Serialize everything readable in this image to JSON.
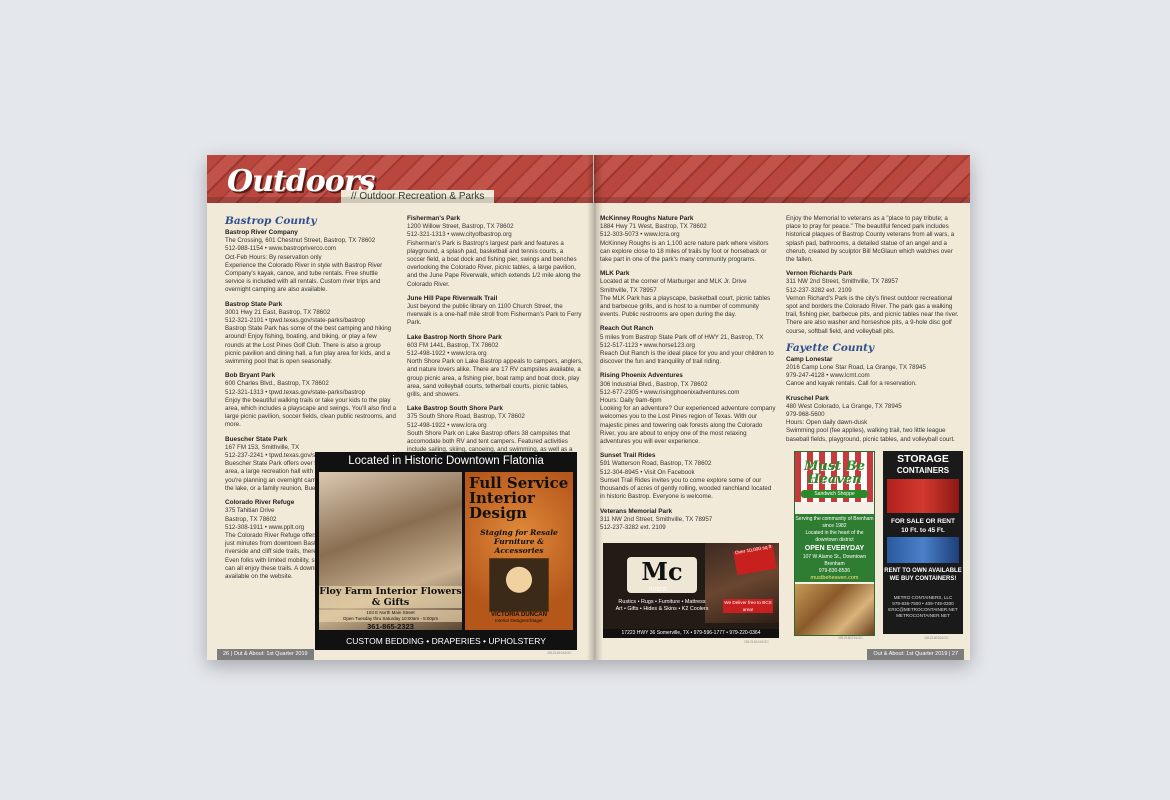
{
  "header": {
    "title": "Outdoors",
    "subtitle": "// Outdoor Recreation & Parks"
  },
  "left_page": {
    "col1": [
      {
        "type": "county",
        "text": "Bastrop County"
      },
      {
        "type": "entry",
        "name": "Bastrop River Company",
        "body": "The Crossing, 601 Chestnut Street, Bastrop, TX 78602\n512-988-1154 • www.bastropriverco.com\nOct-Feb Hours: By reservation only\nExperience the Colorado River in style with Bastrop River Company's kayak, canoe, and tube rentals. Free shuttle service is included with all rentals. Custom river trips and overnight camping are also available."
      },
      {
        "type": "entry",
        "name": "Bastrop State Park",
        "body": "3001 Hwy 21 East, Bastrop, TX 78602\n512-321-2101 • tpwd.texas.gov/state-parks/bastrop\nBastrop State Park has some of the best camping and hiking around! Enjoy fishing, boating, and biking, or play a few rounds at the Lost Pines Golf Club. There is also a group picnic pavilion and dining hall, a fun play area for kids, and a swimming pool that is open seasonally."
      },
      {
        "type": "entry",
        "name": "Bob Bryant Park",
        "body": "600 Charles Blvd., Bastrop, TX 78602\n512-321-1313 • tpwd.texas.gov/state-parks/bastrop\nEnjoy the beautiful walking trails or take your kids to the play area, which includes a playscape and swings. You'll also find a large picnic pavilion, soccer fields, clean public restrooms, and more."
      },
      {
        "type": "entry",
        "name": "Buescher State Park",
        "body": "167 FM 153, Smithville, TX\n512-237-2241 • tpwd.texas.gov/state-parks/buescher\nBuescher State Park offers over 50 campsites, a group picnic area, a large recreation hall with a kitchen, and more. Whether you're planning an overnight camping trip, a day of fishing at the lake, or a family reunion, Buescher State Park has it all."
      },
      {
        "type": "entry",
        "name": "Colorado River Refuge",
        "body": "375 Tahitian Drive\nBastrop, TX 78602\n512-308-1911 • www.pplt.org\nThe Colorado River Refuge offers a true nature experience just minutes from downtown Bastrop. With over 2 miles of riverside and cliff side trails, there is something for everyone. Even folks with limited mobility, strollers, and young children can all enjoy these trails. A downloadable Trail Guide is available on the website."
      }
    ],
    "col2": [
      {
        "type": "entry",
        "name": "Fisherman's Park",
        "body": "1200 Willow Street, Bastrop, TX 78602\n512-321-1313 • www.cityofbastrop.org\nFisherman's Park is Bastrop's largest park and features a playground, a splash pad, basketball and tennis courts, a soccer field, a boat dock and fishing pier, swings and benches overlooking the Colorado River, picnic tables, a large pavilion, and the June Pape Riverwalk, which extends 1/2 mile along the Colorado River."
      },
      {
        "type": "entry",
        "name": "June Hill Pape Riverwalk Trail",
        "body": "Just beyond the public library on 1100 Church Street, the riverwalk is a one-half mile stroll from Fisherman's Park to Ferry Park."
      },
      {
        "type": "entry",
        "name": "Lake Bastrop North Shore Park",
        "body": "603 FM 1441, Bastrop, TX 78602\n512-498-1922 • www.lcra.org\nNorth Shore Park on Lake Bastrop appeals to campers, anglers, and nature lovers alike. There are 17 RV campsites available, a group picnic area, a fishing pier, boat ramp and boat dock, play area, sand volleyball courts, tetherball courts, picnic tables, grills, and showers."
      },
      {
        "type": "entry",
        "name": "Lake Bastrop South Shore Park",
        "body": "375 South Shore Road, Bastrop, TX 78602\n512-498-1922 • www.lcra.org\nSouth Shore Park on Lake Bastrop offers 38 campsites that accomodate both RV and tent campers. Featured activities include sailing, skiing, canoeing, and swimming, as well as a hike and bike trail, tetherball courts, and Osprey Point Hall."
      }
    ],
    "footer": "26 | Out & About: 1st Quarter 2019"
  },
  "right_page": {
    "col1": [
      {
        "type": "entry",
        "name": "McKinney Roughs Nature Park",
        "body": "1884 Hwy 71 West, Bastrop, TX 78602\n512-303-5073 • www.lcra.org\nMcKinney Roughs is an 1,100 acre nature park where visitors can explore close to 18 miles of trails by foot or horseback or take part in one of the park's many community programs."
      },
      {
        "type": "entry",
        "name": "MLK Park",
        "body": "Located at the corner of Marburger and MLK Jr. Drive\nSmithville, TX 78957\nThe MLK Park has a playscape, basketball court, picnic tables and barbecue grills, and is host to a number of community events. Public restrooms are open during the day."
      },
      {
        "type": "entry",
        "name": "Reach Out Ranch",
        "body": "5 miles from Bastrop State Park off of HWY 21, Bastrop, TX\n512-517-1123 • www.horse123.org\nReach Out Ranch is the ideal place for you and your children to discover the fun and tranquility of trail riding."
      },
      {
        "type": "entry",
        "name": "Rising Phoenix Adventures",
        "body": "306 Industrial Blvd., Bastrop, TX 78602\n512-677-2305 • www.risingphoenixadventures.com\nHours: Daily 9am-6pm\nLooking for an adventure? Our experienced adventure company welcomes you to the Lost Pines region of Texas. With our majestic pines and towering oak forests along the Colorado River, you are about to enjoy one of the most relaxing adventures you will ever experience."
      },
      {
        "type": "entry",
        "name": "Sunset Trail Rides",
        "body": "591 Watterson Road, Bastrop, TX 78602\n512-304-8945 • Visit On Facebook\nSunset Trail Rides invites you to come explore some of our thousands of acres of gently rolling, wooded ranchland located in historic Bastrop. Everyone is welcome."
      },
      {
        "type": "entry",
        "name": "Veterans Memorial Park",
        "body": "311 NW 2nd Street, Smithville, TX 78957\n512-237-3282 ext. 2109"
      }
    ],
    "col2": [
      {
        "type": "entry",
        "name": "",
        "body": "Enjoy the Memorial to veterans as a \"place to pay tribute; a place to pray for peace.\" The beautiful fenced park includes historical plaques of Bastrop County veterans from all wars, a splash pad, bathrooms, a detailed statue of an angel and a cherub, created by sculptor Bill McGlaun which watches over the fallen."
      },
      {
        "type": "entry",
        "name": "Vernon Richards Park",
        "body": "311 NW 2nd Street, Smithville, TX 78957\n512-237-3282 ext. 2109\nVernon Richard's Park is the city's finest outdoor recreational spot and borders the Colorado River. The park gas a walking trail, fishing pier, barbecue pits, and picnic tables near the river. There are also washer and horseshoe pits, a 9-hole disc golf course, softball field, and volleyball pits."
      },
      {
        "type": "county",
        "text": "Fayette County"
      },
      {
        "type": "entry",
        "name": "Camp Lonestar",
        "body": "2016 Camp Lone Star Road, La Grange, TX 78945\n979-247-4128 • www.lcmt.com\nCanoe and kayak rentals. Call for a reservation."
      },
      {
        "type": "entry",
        "name": "Kruschel Park",
        "body": "480 West Colorado, La Grange, TX 78945\n979-968-5600\nHours: Open daily dawn-dusk\nSwimming pool (fee applies), walking trail, two little league baseball fields, playground, picnic tables, and volleyball court."
      }
    ],
    "footer": "Out & About: 1st Quarter 2019 | 27"
  },
  "ads": {
    "flatonia": {
      "headline": "Located in Historic Downtown Flatonia",
      "store": "Floy Farm Interior Flowers & Gifts",
      "address": "103 E North Main Street\nOpen Tuesday thru Saturday 10:00am - 5:00pm",
      "phone": "361-865-2323",
      "service_title": "Full Service Interior Design",
      "service_sub": "Staging for Resale Furniture & Accessories",
      "designer": "VICTORIA DUNCAN",
      "designer_title": "Interior Designer/Stager",
      "footer": "CUSTOM BEDDING • DRAPERIES • UPHOLSTERY",
      "code": "1512161041OC"
    },
    "mc": {
      "logo": "Mc",
      "logo_sub": "RUSTIC",
      "burst": "Over 10,000 sq ft",
      "line1": "Rustics • Rugs • Furniture • Mattress",
      "line2": "Art • Gifts • Hides & Skins • K2 Coolers",
      "deliver": "We Deliver free to BCS area!",
      "address": "17223 HWY 36 Somerville, TX • 979-596-1777 • 979-220-0364",
      "code": "1512161041OC"
    },
    "heaven": {
      "name": "Must Be Heaven",
      "sub": "Sandwich Shoppe",
      "serving": "Serving the community of Brenham since 1982",
      "located": "Located in the heart of the downtown district",
      "open": "OPEN EVERYDAY",
      "address": "107 W Alamo St., Downtown Brenham",
      "phone": "979-830-8536",
      "web": "mustbeheaven.com",
      "code": "1512160741OC"
    },
    "storage": {
      "title1": "STORAGE",
      "title2": "CONTAINERS",
      "sale": "FOR SALE OR RENT\n10 Ft. to 45 Ft.",
      "rent": "RENT TO OWN AVAILABLE\nWE BUY CONTAINERS!",
      "company": "METRO CONTAINERS, LLC\n979-836-7500 • 409-749-0300\nERIC@METROCONTAINER.NET\nMETROCONTAINER.NET",
      "code": "1512160321OC"
    }
  }
}
